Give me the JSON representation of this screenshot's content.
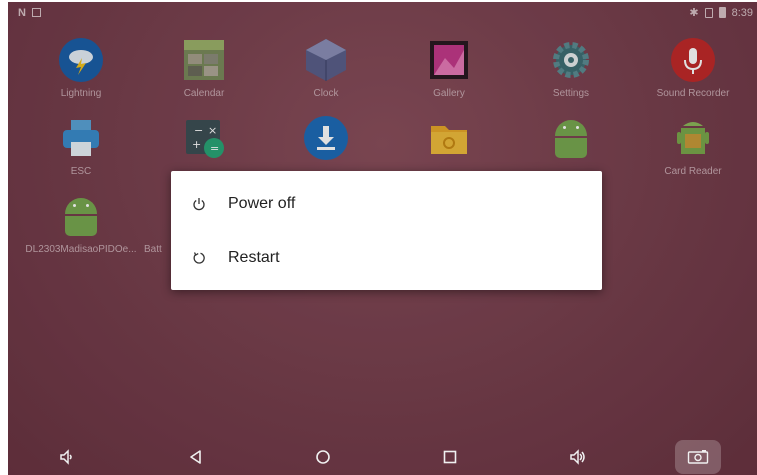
{
  "status_bar": {
    "time": "8:39",
    "left_icons": [
      "n-notification-icon",
      "image-notification-icon"
    ],
    "right_icons": [
      "bluetooth-icon",
      "sim-icon",
      "battery-icon"
    ]
  },
  "apps": [
    {
      "label": "Lightning",
      "icon": "lightning-icon"
    },
    {
      "label": "Calendar",
      "icon": "calendar-icon"
    },
    {
      "label": "Clock",
      "icon": "clock-icon"
    },
    {
      "label": "Gallery",
      "icon": "gallery-icon"
    },
    {
      "label": "Settings",
      "icon": "settings-icon"
    },
    {
      "label": "Sound Recorder",
      "icon": "microphone-icon"
    },
    {
      "label": "ESC",
      "icon": "printer-icon"
    },
    {
      "label": "",
      "icon": "calculator-icon"
    },
    {
      "label": "",
      "icon": "download-icon"
    },
    {
      "label": "",
      "icon": "folder-icon"
    },
    {
      "label": "",
      "icon": "android-icon"
    },
    {
      "label": "Card Reader",
      "icon": "android-box-icon"
    },
    {
      "label": "DL2303MadisaoPIDOe...",
      "icon": "android-icon"
    },
    {
      "label": "Batt",
      "icon": ""
    }
  ],
  "power_dialog": {
    "options": [
      {
        "label": "Power off",
        "icon": "power-icon"
      },
      {
        "label": "Restart",
        "icon": "restart-icon"
      }
    ]
  },
  "nav_bar": {
    "buttons": [
      "volume-down-icon",
      "back-icon",
      "home-icon",
      "recents-icon",
      "volume-up-icon",
      "screenshot-icon"
    ]
  },
  "colors": {
    "wallpaper": "#7a4250",
    "dialog_bg": "#ffffff",
    "text": "#222222"
  }
}
